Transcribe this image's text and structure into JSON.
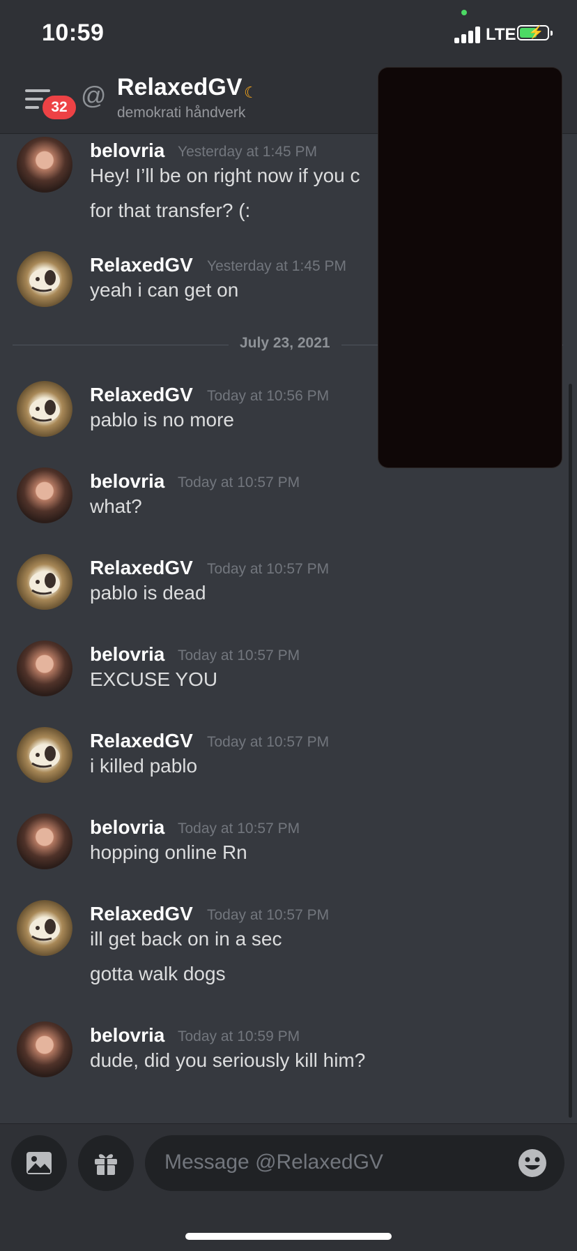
{
  "status_bar": {
    "time": "10:59",
    "network": "LTE"
  },
  "header": {
    "unread_count": "32",
    "channel_name": "RelaxedGV",
    "channel_subtitle": "demokrati håndverk"
  },
  "messages": [
    {
      "author": "belovria",
      "timestamp": "Yesterday at 1:45 PM",
      "lines": [
        "Hey! I’ll be on right now if you c",
        "for that transfer? (:"
      ]
    },
    {
      "author": "RelaxedGV",
      "timestamp": "Yesterday at 1:45 PM",
      "lines": [
        "yeah i can get on"
      ]
    },
    {
      "author": "RelaxedGV",
      "timestamp": "Today at 10:56 PM",
      "lines": [
        "pablo is no more"
      ]
    },
    {
      "author": "belovria",
      "timestamp": "Today at 10:57 PM",
      "lines": [
        "what?"
      ]
    },
    {
      "author": "RelaxedGV",
      "timestamp": "Today at 10:57 PM",
      "lines": [
        "pablo is dead"
      ]
    },
    {
      "author": "belovria",
      "timestamp": "Today at 10:57 PM",
      "lines": [
        "EXCUSE YOU"
      ]
    },
    {
      "author": "RelaxedGV",
      "timestamp": "Today at 10:57 PM",
      "lines": [
        "i killed pablo"
      ]
    },
    {
      "author": "belovria",
      "timestamp": "Today at 10:57 PM",
      "lines": [
        "hopping online Rn"
      ]
    },
    {
      "author": "RelaxedGV",
      "timestamp": "Today at 10:57 PM",
      "lines": [
        "ill get back on in a sec",
        "gotta walk dogs"
      ]
    },
    {
      "author": "belovria",
      "timestamp": "Today at 10:59 PM",
      "lines": [
        "dude, did you seriously kill him?"
      ]
    }
  ],
  "date_divider": "July 23, 2021",
  "composer": {
    "placeholder": "Message @RelaxedGV"
  },
  "icons": [
    "hamburger-menu-icon",
    "at-icon",
    "idle-moon-icon",
    "image-icon",
    "gift-icon",
    "emoji-icon"
  ],
  "colors": {
    "background": "#36393f",
    "header": "#2f3136",
    "badge": "#ed4245",
    "idle": "#faa81a"
  }
}
